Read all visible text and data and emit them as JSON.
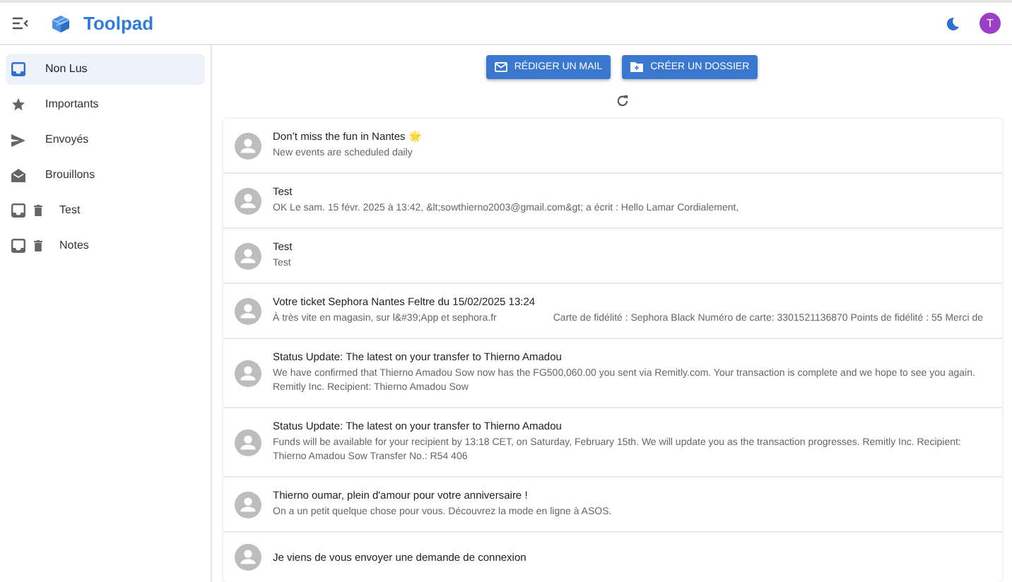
{
  "app": {
    "title": "Toolpad",
    "avatar_initial": "T"
  },
  "sidebar": {
    "items": [
      {
        "label": "Non Lus",
        "kind": "inbox",
        "selected": true
      },
      {
        "label": "Importants",
        "kind": "star",
        "selected": false
      },
      {
        "label": "Envoyés",
        "kind": "send",
        "selected": false
      },
      {
        "label": "Brouillons",
        "kind": "drafts",
        "selected": false
      },
      {
        "label": "Test",
        "kind": "folder",
        "selected": false
      },
      {
        "label": "Notes",
        "kind": "folder",
        "selected": false
      }
    ]
  },
  "actions": [
    {
      "label": "RÉDIGER UN MAIL",
      "kind": "mail"
    },
    {
      "label": "CRÉER UN DOSSIER",
      "kind": "folder"
    }
  ],
  "messages": [
    {
      "subject": "Don’t miss the fun in Nantes 🌟",
      "preview": [
        "New events are scheduled daily"
      ]
    },
    {
      "subject": "Test",
      "preview": [
        "OK Le sam. 15 févr. 2025 à 13:42, &lt;sowthierno2003@gmail.com&gt; a écrit : Hello Lamar Cordialement,"
      ]
    },
    {
      "subject": "Test",
      "preview": [
        "Test"
      ]
    },
    {
      "subject": "Votre ticket Sephora Nantes Feltre du 15/02/2025 13:24",
      "preview": [
        "À très vite en magasin, sur l&#39;App et sephora.fr",
        "Carte de fidélité : Sephora Black Numéro de carte: 3301521136870 Points de fidélité : 55 Merci de"
      ]
    },
    {
      "subject": "Status Update: The latest on your transfer to Thierno Amadou",
      "preview": [
        "We have confirmed that Thierno Amadou Sow now has the FG500,060.00 you sent via Remitly.com. Your transaction is complete and we hope to see you again. Remitly Inc. Recipient: Thierno Amadou Sow"
      ]
    },
    {
      "subject": "Status Update: The latest on your transfer to Thierno Amadou",
      "preview": [
        "Funds will be available for your recipient by 13:18 CET, on Saturday, February 15th. We will update you as the transaction progresses. Remitly Inc. Recipient: Thierno Amadou Sow Transfer No.: R54 406"
      ]
    },
    {
      "subject": "Thierno oumar, plein d'amour pour votre anniversaire !",
      "preview": [
        "On a un petit quelque chose pour vous. Découvrez la mode en ligne à ASOS."
      ]
    },
    {
      "subject": "Je viens de vous envoyer une demande de connexion"
    }
  ]
}
